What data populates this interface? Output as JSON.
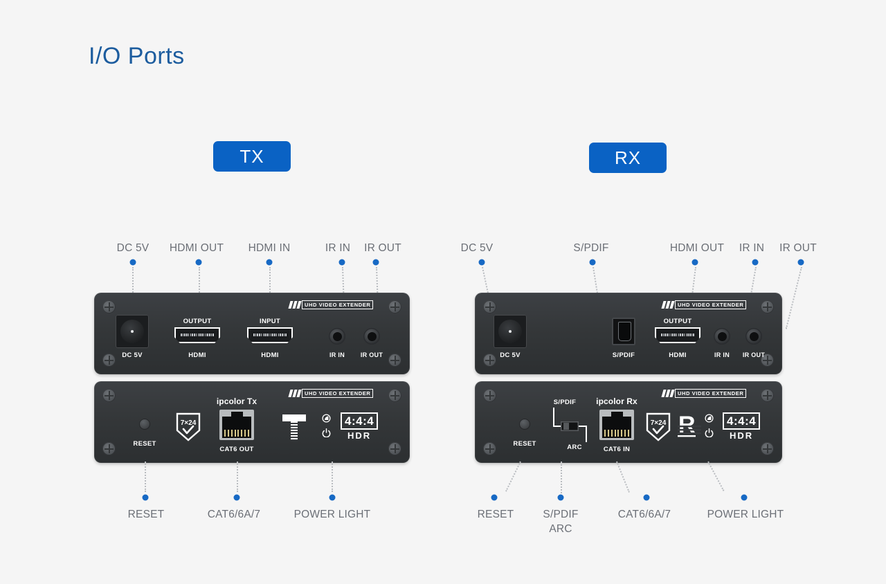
{
  "page": {
    "title": "I/O Ports",
    "background": "#f5f5f5",
    "accent_blue": "#0a62c4",
    "title_color": "#1c5c9e",
    "label_color": "#6b6f76"
  },
  "badges": {
    "tx": "TX",
    "rx": "RX"
  },
  "tx": {
    "front": {
      "brand_badge": "UHD VIDEO EXTENDER",
      "ports": [
        {
          "callout": "DC 5V",
          "panel_top": "",
          "panel_bottom": "DC 5V"
        },
        {
          "callout": "HDMI OUT",
          "panel_top": "OUTPUT",
          "panel_bottom": "HDMI"
        },
        {
          "callout": "HDMI IN",
          "panel_top": "INPUT",
          "panel_bottom": "HDMI"
        },
        {
          "callout": "IR IN",
          "panel_top": "",
          "panel_bottom": "IR IN"
        },
        {
          "callout": "IR OUT",
          "panel_top": "",
          "panel_bottom": "IR OUT"
        }
      ]
    },
    "rear": {
      "brand_badge": "UHD VIDEO EXTENDER",
      "model_label": "ipcolor Tx",
      "reset_label": "RESET",
      "rj45_label": "CAT6 OUT",
      "shield_text": "7×24",
      "hdr_numbers": "4:4:4",
      "hdr_text": "HDR",
      "callouts": [
        "RESET",
        "CAT6/6A/7",
        "POWER LIGHT"
      ]
    }
  },
  "rx": {
    "front": {
      "brand_badge": "UHD VIDEO EXTENDER",
      "ports": [
        {
          "callout": "DC 5V",
          "panel_top": "",
          "panel_bottom": "DC 5V"
        },
        {
          "callout": "S/PDIF",
          "panel_top": "",
          "panel_bottom": "S/PDIF"
        },
        {
          "callout": "HDMI OUT",
          "panel_top": "OUTPUT",
          "panel_bottom": "HDMI"
        },
        {
          "callout": "IR IN",
          "panel_top": "",
          "panel_bottom": "IR IN"
        },
        {
          "callout": "IR OUT",
          "panel_top": "",
          "panel_bottom": "IR OUT"
        }
      ]
    },
    "rear": {
      "brand_badge": "UHD VIDEO EXTENDER",
      "model_label": "ipcolor Rx",
      "reset_label": "RESET",
      "switch_top_label": "S/PDIF",
      "switch_bottom_label": "ARC",
      "rj45_label": "CAT6 IN",
      "shield_text": "7×24",
      "r_logo": "R",
      "hdr_numbers": "4:4:4",
      "hdr_text": "HDR",
      "callouts": [
        "RESET",
        "S/PDIF",
        "ARC",
        "CAT6/6A/7",
        "POWER LIGHT"
      ]
    }
  }
}
